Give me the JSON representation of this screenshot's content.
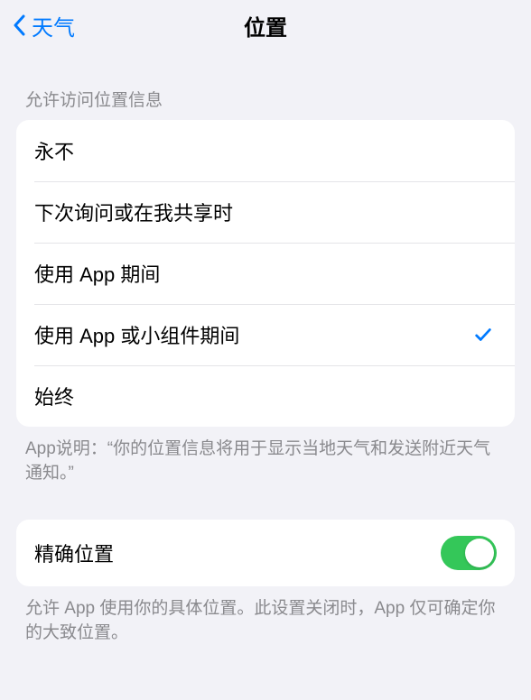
{
  "header": {
    "back_label": "天气",
    "title": "位置"
  },
  "section1": {
    "header": "允许访问位置信息",
    "options": [
      {
        "label": "永不"
      },
      {
        "label": "下次询问或在我共享时"
      },
      {
        "label": "使用 App 期间"
      },
      {
        "label": "使用 App 或小组件期间",
        "selected": true
      },
      {
        "label": "始终"
      }
    ],
    "footer": "App说明：“你的位置信息将用于显示当地天气和发送附近天气通知。”"
  },
  "section2": {
    "precise_label": "精确位置",
    "precise_on": true,
    "footer": "允许 App 使用你的具体位置。此设置关闭时，App 仅可确定你的大致位置。"
  }
}
